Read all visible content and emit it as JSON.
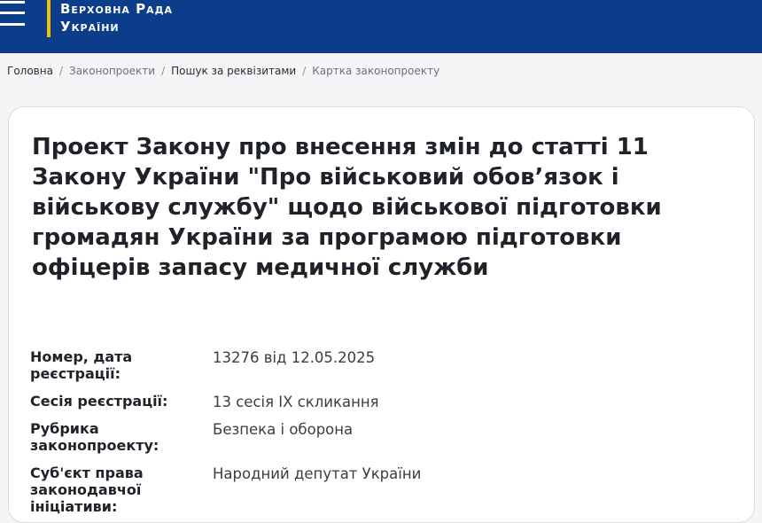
{
  "header": {
    "brand_line1": "Верховна Рада",
    "brand_line2": "України",
    "colors": {
      "background": "#0c3d8a",
      "accent": "#f2c200"
    },
    "menu_icon": "hamburger-menu-icon"
  },
  "breadcrumbs": [
    {
      "label": "Головна"
    },
    {
      "label": "Законопроекти"
    },
    {
      "label": "Пошук за реквізитами"
    },
    {
      "label": "Картка законопроекту"
    }
  ],
  "bill": {
    "title": "Проект Закону про внесення змін до статті 11 Закону України \"Про військовий обов’язок і військову службу\" щодо військової підготовки громадян України за програмою підготовки офіцерів запасу медичної служби",
    "fields": [
      {
        "label": "Номер, дата реєстрації:",
        "value": "13276 від 12.05.2025"
      },
      {
        "label": "Сесія реєстрації:",
        "value": "13 сесія IX скликання"
      },
      {
        "label": "Рубрика законопроекту:",
        "value": "Безпека і оборона"
      },
      {
        "label": "Суб'єкт права законодавчої ініціативи:",
        "value": "Народний депутат України"
      }
    ]
  }
}
